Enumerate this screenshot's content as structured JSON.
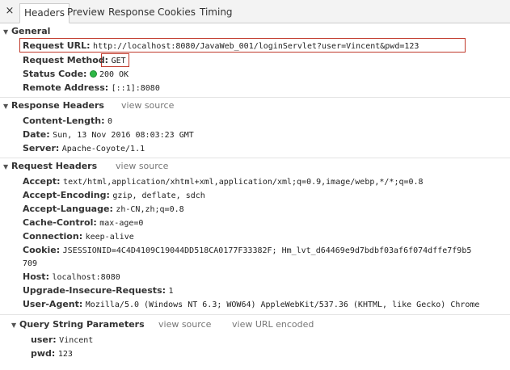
{
  "tabs": {
    "close": "×",
    "items": [
      "Headers",
      "Preview",
      "Response",
      "Cookies",
      "Timing"
    ],
    "active": "Headers"
  },
  "general": {
    "title": "General",
    "request_url_key": "Request URL:",
    "request_url": "http://localhost:8080/JavaWeb_001/loginServlet?user=Vincent&pwd=123",
    "method_key": "Request Method:",
    "method": "GET",
    "status_key": "Status Code:",
    "status": "200 OK",
    "status_color": "#2db745",
    "remote_key": "Remote Address:",
    "remote": "[::1]:8080",
    "highlight_color": "#c0392b"
  },
  "response_headers": {
    "title": "Response Headers",
    "view_source": "view source",
    "rows": [
      {
        "key": "Content-Length:",
        "value": "0"
      },
      {
        "key": "Date:",
        "value": "Sun, 13 Nov 2016 08:03:23 GMT"
      },
      {
        "key": "Server:",
        "value": "Apache-Coyote/1.1"
      }
    ]
  },
  "request_headers": {
    "title": "Request Headers",
    "view_source": "view source",
    "rows": [
      {
        "key": "Accept:",
        "value": "text/html,application/xhtml+xml,application/xml;q=0.9,image/webp,*/*;q=0.8"
      },
      {
        "key": "Accept-Encoding:",
        "value": "gzip, deflate, sdch"
      },
      {
        "key": "Accept-Language:",
        "value": "zh-CN,zh;q=0.8"
      },
      {
        "key": "Cache-Control:",
        "value": "max-age=0"
      },
      {
        "key": "Connection:",
        "value": "keep-alive"
      },
      {
        "key": "Cookie:",
        "value": "JSESSIONID=4C4D4109C19044DD518CA0177F33382F; Hm_lvt_d64469e9d7bdbf03af6f074dffe7f9b5",
        "continuation": "709"
      },
      {
        "key": "Host:",
        "value": "localhost:8080"
      },
      {
        "key": "Upgrade-Insecure-Requests:",
        "value": "1"
      },
      {
        "key": "User-Agent:",
        "value": "Mozilla/5.0 (Windows NT 6.3; WOW64) AppleWebKit/537.36 (KHTML, like Gecko) Chrome"
      }
    ]
  },
  "query_params": {
    "title": "Query String Parameters",
    "view_source": "view source",
    "view_encoded": "view URL encoded",
    "rows": [
      {
        "key": "user:",
        "value": "Vincent"
      },
      {
        "key": "pwd:",
        "value": "123"
      }
    ]
  }
}
